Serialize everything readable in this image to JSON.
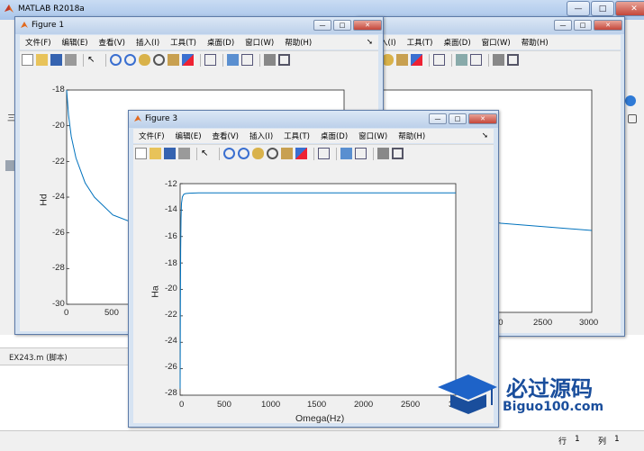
{
  "matlab": {
    "title": "MATLAB R2018a",
    "editor_label": "EX243.m  (脚本)",
    "status": {
      "row_label": "行",
      "row": "1",
      "col_label": "列",
      "col": "1"
    }
  },
  "figure1": {
    "title": "Figure 1",
    "menu": [
      "文件(F)",
      "编辑(E)",
      "查看(V)",
      "插入(I)",
      "工具(T)",
      "桌面(D)",
      "窗口(W)",
      "帮助(H)"
    ],
    "ylabel": "Hd",
    "yticks": [
      "-18",
      "-20",
      "-22",
      "-24",
      "-26",
      "-28",
      "-30"
    ],
    "xticks": [
      "0",
      "500"
    ]
  },
  "figure2": {
    "menu": [
      "入(I)",
      "工具(T)",
      "桌面(D)",
      "窗口(W)",
      "帮助(H)"
    ],
    "xticks": [
      "00",
      "2500",
      "3000"
    ]
  },
  "figure3": {
    "title": "Figure 3",
    "menu": [
      "文件(F)",
      "编辑(E)",
      "查看(V)",
      "插入(I)",
      "工具(T)",
      "桌面(D)",
      "窗口(W)",
      "帮助(H)"
    ],
    "ylabel": "Ha",
    "xlabel": "Omega(Hz)",
    "yticks": [
      "-12",
      "-14",
      "-16",
      "-18",
      "-20",
      "-22",
      "-24",
      "-26",
      "-28"
    ],
    "xticks": [
      "0",
      "500",
      "1000",
      "1500",
      "2000",
      "2500",
      "30"
    ]
  },
  "watermark": {
    "brand": "必过源码",
    "url": "Biguo100.com"
  },
  "chart_data": [
    {
      "type": "line",
      "figure": "Figure 1",
      "ylabel": "Hd",
      "xlim": [
        0,
        3000
      ],
      "ylim": [
        -30,
        -18
      ],
      "x": [
        0,
        20,
        50,
        100,
        200,
        300,
        500,
        800,
        1200,
        1600,
        2000,
        2500,
        3000
      ],
      "y": [
        -18,
        -19.4,
        -20.6,
        -21.8,
        -23.2,
        -24.0,
        -25.0,
        -25.6,
        -26.0,
        -26.2,
        -26.3,
        -26.4,
        -26.5
      ]
    },
    {
      "type": "line",
      "figure": "Figure 3",
      "ylabel": "Ha",
      "xlabel": "Omega(Hz)",
      "xlim": [
        0,
        3000
      ],
      "ylim": [
        -28,
        -12
      ],
      "x": [
        0,
        3,
        6,
        10,
        15,
        25,
        40,
        60,
        100,
        200,
        500,
        1000,
        2000,
        3000
      ],
      "y": [
        -27.5,
        -21,
        -17,
        -14.6,
        -13.5,
        -13.0,
        -12.8,
        -12.75,
        -12.72,
        -12.7,
        -12.7,
        -12.7,
        -12.7,
        -12.7
      ]
    }
  ]
}
